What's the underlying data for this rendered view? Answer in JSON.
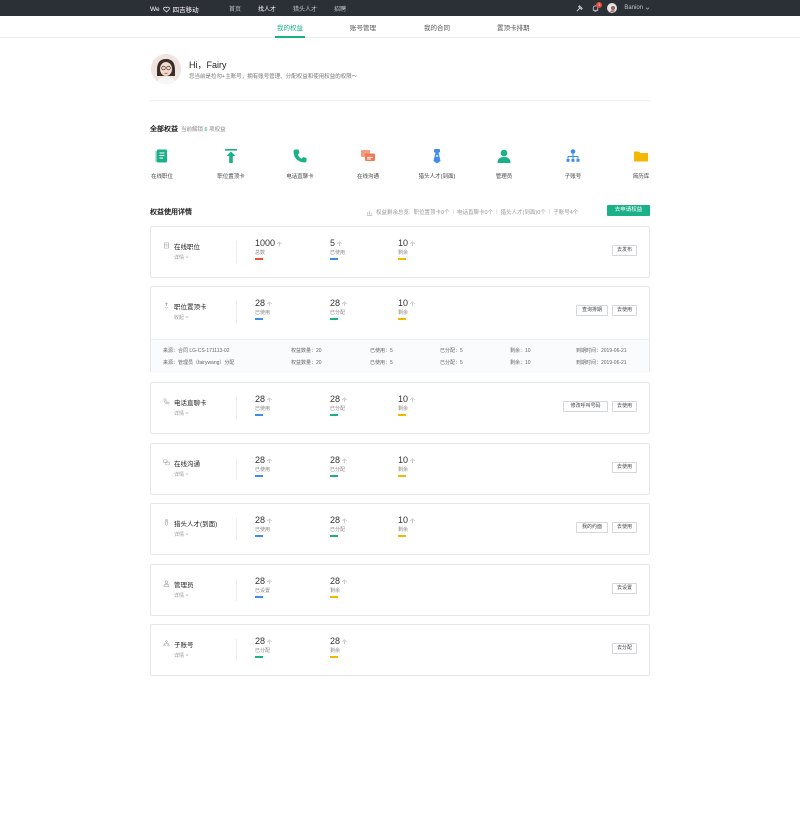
{
  "topbar": {
    "brand_prefix": "We",
    "brand_name": "四吉移动",
    "nav": [
      "首页",
      "找人才",
      "猎头人才",
      "招聘"
    ],
    "active_nav": 1,
    "badge_count": "1",
    "username": "Banion"
  },
  "subtabs": [
    "我的权益",
    "账号管理",
    "我的合同",
    "置顶卡排期"
  ],
  "profile": {
    "greeting": "Hi，Fairy",
    "desc": "您当前是拉勾+主账号，拥有账号管理、分配权益和使用权益的权限～"
  },
  "all_rights": {
    "title": "全部权益",
    "sub_prefix": "当前解锁",
    "count": "6",
    "sub_suffix": "项权益",
    "features": [
      {
        "label": "在线职位",
        "icon": "job-doc-icon",
        "color": "#1ab188"
      },
      {
        "label": "职位置顶卡",
        "icon": "pin-top-icon",
        "color": "#1ab188"
      },
      {
        "label": "电话直聊卡",
        "icon": "phone-icon",
        "color": "#1ab188"
      },
      {
        "label": "在线沟通",
        "icon": "chat-bubbles-icon",
        "color": "#f07a55"
      },
      {
        "label": "猎头人才(到面)",
        "icon": "headhunter-tie-icon",
        "color": "#3f8de8"
      },
      {
        "label": "管理员",
        "icon": "admin-user-icon",
        "color": "#1ab188"
      },
      {
        "label": "子账号",
        "icon": "org-tree-icon",
        "color": "#3f8de8"
      },
      {
        "label": "简历库",
        "icon": "folder-icon",
        "color": "#f5b800"
      }
    ]
  },
  "detail": {
    "title": "权益使用详情",
    "summary_prefix": "权益剩余总览:",
    "summary_items": [
      "职位置顶卡0个",
      "电话直聊卡0个",
      "猎头人才(到面)0个",
      "子账号4个"
    ],
    "apply_label": "去申请权益"
  },
  "colors": {
    "accent": "#1ab188",
    "used": "#3f8de8",
    "allocated": "#1ab188",
    "remaining": "#f5b800",
    "total": "#e84c3d"
  },
  "cards": [
    {
      "name": "在线职位",
      "link": "详情",
      "icon": "job-doc-icon",
      "stats": [
        {
          "value": "1000",
          "unit": "个",
          "label": "总数",
          "kind": "total"
        },
        {
          "value": "5",
          "unit": "个",
          "label": "已使用",
          "kind": "used"
        },
        {
          "value": "10",
          "unit": "个",
          "label": "剩余",
          "kind": "remaining"
        }
      ],
      "buttons": [
        "去发布"
      ]
    },
    {
      "name": "职位置顶卡",
      "link": "收起",
      "icon": "pin-top-icon",
      "stats": [
        {
          "value": "28",
          "unit": "个",
          "label": "已使用",
          "kind": "used"
        },
        {
          "value": "28",
          "unit": "个",
          "label": "已分配",
          "kind": "allocated"
        },
        {
          "value": "10",
          "unit": "个",
          "label": "剩余",
          "kind": "remaining"
        }
      ],
      "buttons": [
        "查询排期",
        "去使用"
      ],
      "rows": [
        {
          "source": "来源：合同 LG-CS-171113-02",
          "qty": "权益数量：20",
          "used": "已使用：5",
          "alloc": "已分配：5",
          "remain": "剩余：10",
          "expire": "到期时间：2019-06-21"
        },
        {
          "source": "来源：管理员（fairywang）分配",
          "qty": "权益数量：20",
          "used": "已使用：5",
          "alloc": "已分配：5",
          "remain": "剩余：10",
          "expire": "到期时间：2019-06-21"
        }
      ]
    },
    {
      "name": "电话直聊卡",
      "link": "详情",
      "icon": "phone-icon",
      "stats": [
        {
          "value": "28",
          "unit": "个",
          "label": "已使用",
          "kind": "used"
        },
        {
          "value": "28",
          "unit": "个",
          "label": "已分配",
          "kind": "allocated"
        },
        {
          "value": "10",
          "unit": "个",
          "label": "剩余",
          "kind": "remaining"
        }
      ],
      "buttons": [
        "修改呼叫号码",
        "去使用"
      ]
    },
    {
      "name": "在线沟通",
      "link": "详情",
      "icon": "chat-bubbles-icon",
      "stats": [
        {
          "value": "28",
          "unit": "个",
          "label": "已使用",
          "kind": "used"
        },
        {
          "value": "28",
          "unit": "个",
          "label": "已分配",
          "kind": "allocated"
        },
        {
          "value": "10",
          "unit": "个",
          "label": "剩余",
          "kind": "remaining"
        }
      ],
      "buttons": [
        "去使用"
      ]
    },
    {
      "name": "猎头人才(到面)",
      "link": "详情",
      "icon": "headhunter-tie-icon",
      "stats": [
        {
          "value": "28",
          "unit": "个",
          "label": "已使用",
          "kind": "used"
        },
        {
          "value": "28",
          "unit": "个",
          "label": "已分配",
          "kind": "allocated"
        },
        {
          "value": "10",
          "unit": "个",
          "label": "剩余",
          "kind": "remaining"
        }
      ],
      "buttons": [
        "我的约面",
        "去使用"
      ]
    },
    {
      "name": "管理员",
      "link": "详情",
      "icon": "admin-user-icon",
      "stats": [
        {
          "value": "28",
          "unit": "个",
          "label": "已设置",
          "kind": "used"
        },
        {
          "value": "28",
          "unit": "个",
          "label": "剩余",
          "kind": "remaining"
        }
      ],
      "buttons": [
        "去设置"
      ]
    },
    {
      "name": "子账号",
      "link": "详情",
      "icon": "org-tree-icon",
      "stats": [
        {
          "value": "28",
          "unit": "个",
          "label": "已分配",
          "kind": "allocated"
        },
        {
          "value": "28",
          "unit": "个",
          "label": "剩余",
          "kind": "remaining"
        }
      ],
      "buttons": [
        "去分配"
      ]
    }
  ]
}
